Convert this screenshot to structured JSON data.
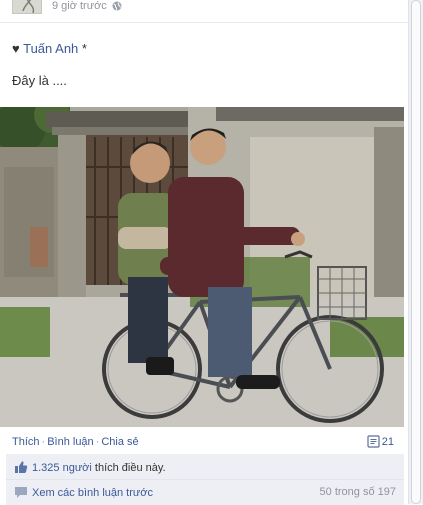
{
  "post": {
    "timestamp": "9 giờ trước",
    "audience_icon": "globe-icon",
    "author_prefix": "♥",
    "author_name": "Tuấn Anh",
    "author_suffix": "*",
    "message": "Đây là ....",
    "photo_description_icon": "photo"
  },
  "actions": {
    "like": "Thích",
    "comment": "Bình luận",
    "share": "Chia sẻ",
    "dot": "·",
    "share_count": "21",
    "share_icon": "share-count-icon"
  },
  "ufi": {
    "likes_count": "1.325 người",
    "likes_text": "thích điều này.",
    "view_comments": "Xem các bình luận trước",
    "pager": "50 trong số 197"
  },
  "colors": {
    "link": "#3b5998",
    "ufi_bg": "#edeff4",
    "meta": "#90949c"
  }
}
